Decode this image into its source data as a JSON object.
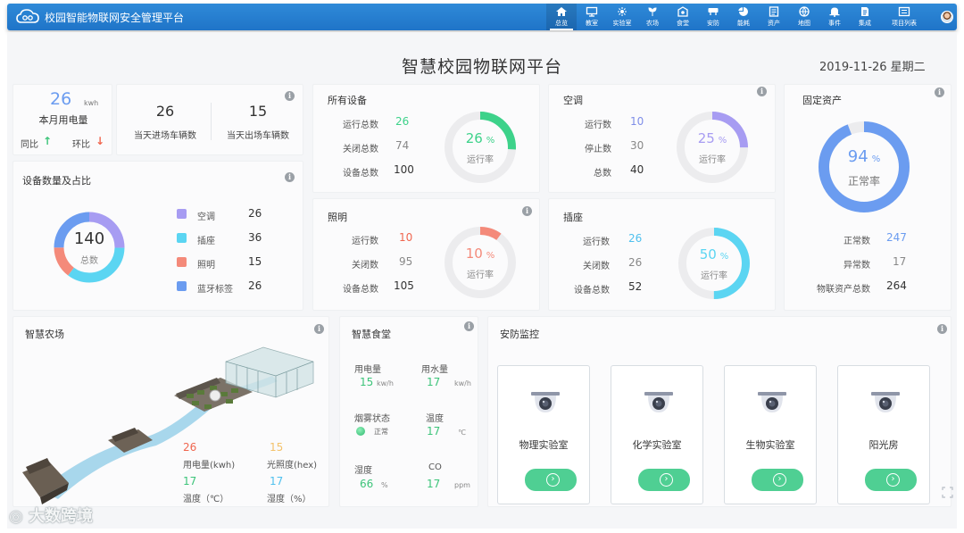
{
  "app": {
    "title": "校园智能物联网安全管理平台"
  },
  "nav": [
    {
      "label": "总览",
      "icon": "home-icon"
    },
    {
      "label": "教室",
      "icon": "classroom-icon"
    },
    {
      "label": "实验室",
      "icon": "lab-icon"
    },
    {
      "label": "农场",
      "icon": "farm-icon"
    },
    {
      "label": "食堂",
      "icon": "canteen-icon"
    },
    {
      "label": "安防",
      "icon": "security-icon"
    },
    {
      "label": "能耗",
      "icon": "energy-icon"
    },
    {
      "label": "资产",
      "icon": "asset-icon"
    },
    {
      "label": "地图",
      "icon": "map-icon"
    },
    {
      "label": "事件",
      "icon": "bell-icon"
    },
    {
      "label": "集成",
      "icon": "integration-icon"
    },
    {
      "label": "项目列表",
      "icon": "project-list-icon"
    }
  ],
  "header": {
    "title": "智慧校园物联网平台",
    "date": "2019-11-26 星期二"
  },
  "electricity": {
    "value": "26",
    "unit": "kwh",
    "label": "本月用电量",
    "yoy": "同比",
    "mom": "环比",
    "yoy_arrow": "↑",
    "mom_arrow": "↓"
  },
  "vehicles": {
    "in_value": "26",
    "in_label": "当天进场车辆数",
    "out_value": "15",
    "out_label": "当天出场车辆数"
  },
  "device_share": {
    "title": "设备数量及占比",
    "total": "140",
    "total_label": "总数",
    "items": [
      {
        "label": "空调",
        "value": "26",
        "color": "#a79cf2"
      },
      {
        "label": "插座",
        "value": "36",
        "color": "#5bd5f2"
      },
      {
        "label": "照明",
        "value": "15",
        "color": "#f48a7a"
      },
      {
        "label": "蓝牙标签",
        "value": "26",
        "color": "#6b9cf0"
      }
    ]
  },
  "all_devices": {
    "title": "所有设备",
    "run_label": "运行总数",
    "run": "26",
    "off_label": "关闭总数",
    "off": "74",
    "total_label": "设备总数",
    "total": "100",
    "rate": "26",
    "rate_unit": "%",
    "rate_label": "运行率",
    "color": "#3dd28a"
  },
  "aircon": {
    "title": "空调",
    "run_label": "运行数",
    "run": "10",
    "off_label": "停止数",
    "off": "30",
    "total_label": "总数",
    "total": "40",
    "rate": "25",
    "rate_unit": "%",
    "rate_label": "运行率",
    "color": "#a79cf2"
  },
  "lighting": {
    "title": "照明",
    "run_label": "运行数",
    "run": "10",
    "off_label": "关闭数",
    "off": "95",
    "total_label": "设备总数",
    "total": "105",
    "rate": "10",
    "rate_unit": "%",
    "rate_label": "运行率",
    "color": "#f48a7a"
  },
  "socket": {
    "title": "插座",
    "run_label": "运行数",
    "run": "26",
    "off_label": "关闭数",
    "off": "26",
    "total_label": "设备总数",
    "total": "52",
    "rate": "50",
    "rate_unit": "%",
    "rate_label": "运行率",
    "color": "#5bd5f2"
  },
  "fixed_assets": {
    "title": "固定资产",
    "rate": "94",
    "rate_unit": "%",
    "rate_label": "正常率",
    "normal_label": "正常数",
    "normal": "247",
    "abnormal_label": "异常数",
    "abnormal": "17",
    "total_label": "物联资产总数",
    "total": "264",
    "color": "#6b9cf0"
  },
  "farm": {
    "title": "智慧农场",
    "electricity": "26",
    "electricity_label": "用电量(kwh)",
    "light": "15",
    "light_label": "光照度(hex)",
    "temperature": "17",
    "temperature_label": "温度（℃）",
    "humidity": "17",
    "humidity_label": "湿度（%）"
  },
  "canteen": {
    "title": "智慧食堂",
    "power_label": "用电量",
    "power": "15",
    "power_unit": "kw/h",
    "water_label": "用水量",
    "water": "17",
    "water_unit": "kw/h",
    "smoke_label": "烟雾状态",
    "smoke_status": "正常",
    "temp_label": "温度",
    "temp": "17",
    "temp_unit": "℃",
    "humidity_label": "湿度",
    "humidity": "66",
    "humidity_unit": "%",
    "co_label": "CO",
    "co": "17",
    "co_unit": "ppm"
  },
  "security": {
    "title": "安防监控",
    "cameras": [
      {
        "label": "物理实验室"
      },
      {
        "label": "化学实验室"
      },
      {
        "label": "生物实验室"
      },
      {
        "label": "阳光房"
      }
    ]
  },
  "watermark": "大数跨境"
}
